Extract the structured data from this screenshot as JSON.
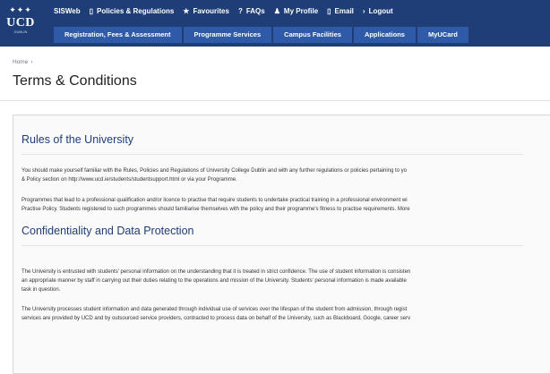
{
  "logo": {
    "crest": "✦✦✦",
    "name": "UCD",
    "subtitle": "DUBLIN"
  },
  "topnav": [
    {
      "icon": "",
      "label": "SISWeb"
    },
    {
      "icon": "▯",
      "label": "Policies & Regulations"
    },
    {
      "icon": "★",
      "label": "Favourites"
    },
    {
      "icon": "?",
      "label": "FAQs"
    },
    {
      "icon": "♟",
      "label": "My Profile"
    },
    {
      "icon": "▯",
      "label": "Email"
    },
    {
      "icon": "›",
      "label": "Logout"
    }
  ],
  "tabs": [
    "Registration, Fees & Assessment",
    "Programme Services",
    "Campus Facilities",
    "Applications",
    "MyUCard"
  ],
  "breadcrumb": {
    "home": "Home",
    "separator": "›"
  },
  "page_title": "Terms & Conditions",
  "sections": [
    {
      "title": "Rules of the University",
      "lines": [
        "You should make yourself familiar with the Rules, Policies and Regulations of University College Dublin and with any further regulations or policies pertaining to yo",
        "& Policy section on http://www.ucd.ie/students/studentsupport.html or via your Programme.",
        "Programmes that lead to a professional qualification and/or licence to practise that require students to undertake practical training in a professional environment wi",
        "Practise Policy. Students registered to such programmes should familiarise themselves with the policy and their programme's fitness to practise requirements. More"
      ]
    },
    {
      "title": "Confidentiality and Data Protection",
      "lines": [
        "The University is entrusted with students' personal information on the understanding that it is treated in strict confidence. The use of student information is consisten",
        "an appropriate manner by staff in carrying out their duties relating to the operations and mission of the University. Students' personal information is made available",
        "task in question.",
        "The University processes student information and data generated through individual use of services over the lifespan of the student from admission, through regist",
        "services are provided by UCD and by outsourced service providers, contracted to process data on behalf of the University, such as Blackboard, Google, career serv"
      ]
    }
  ]
}
